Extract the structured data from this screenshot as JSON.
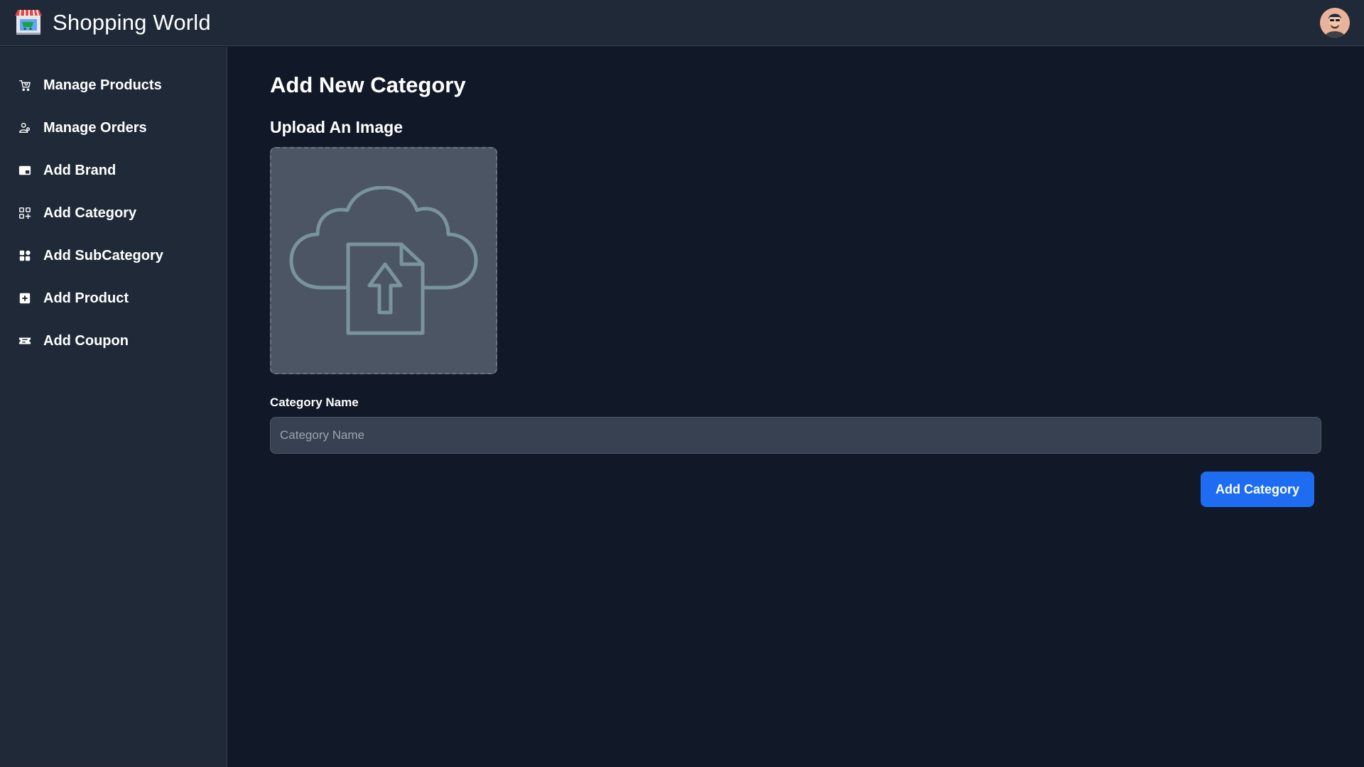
{
  "app": {
    "title": "Shopping World",
    "logo_icon": "storefront-icon",
    "avatar_icon": "user-avatar"
  },
  "sidebar": {
    "items": [
      {
        "label": "Manage Products",
        "icon": "cart-icon"
      },
      {
        "label": "Manage Orders",
        "icon": "users-icon"
      },
      {
        "label": "Add Brand",
        "icon": "card-icon"
      },
      {
        "label": "Add Category",
        "icon": "grid-plus-icon"
      },
      {
        "label": "Add SubCategory",
        "icon": "grid-icon"
      },
      {
        "label": "Add Product",
        "icon": "plus-square-icon"
      },
      {
        "label": "Add Coupon",
        "icon": "ticket-icon"
      }
    ]
  },
  "main": {
    "page_title": "Add New Category",
    "upload_title": "Upload An Image",
    "upload_icon": "cloud-upload-file-icon",
    "category_name_label": "Category Name",
    "category_name_placeholder": "Category Name",
    "category_name_value": "",
    "submit_label": "Add Category"
  },
  "colors": {
    "background": "#111827",
    "sidebar": "#1f2937",
    "input": "#374151",
    "dropzone": "#4b5563",
    "accent": "#1d6cf2"
  }
}
